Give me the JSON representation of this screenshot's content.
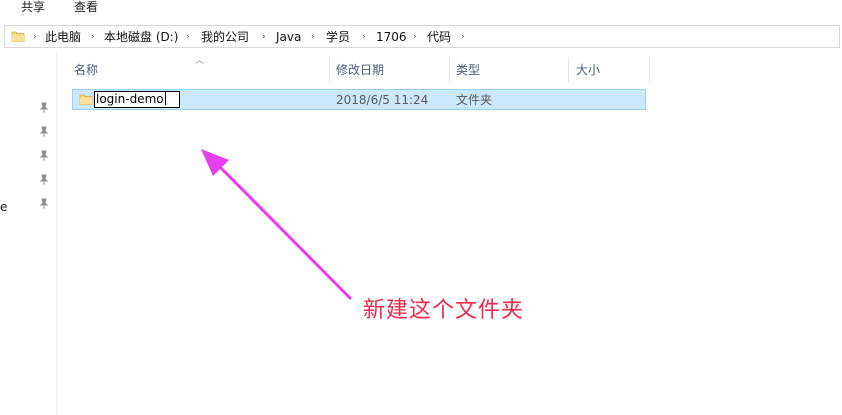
{
  "ribbon": {
    "tabs": [
      "共享",
      "查看"
    ]
  },
  "breadcrumb": {
    "items": [
      "此电脑",
      "本地磁盘 (D:)",
      "我的公司",
      "Java",
      "学员",
      "1706",
      "代码"
    ],
    "separator": "›"
  },
  "navpane": {
    "partial_text": "e"
  },
  "columns": {
    "name": "名称",
    "modified": "修改日期",
    "type": "类型",
    "size": "大小"
  },
  "file": {
    "name": "login-demo",
    "modified": "2018/6/5 11:24",
    "type": "文件夹",
    "size": ""
  },
  "annotation": {
    "text": "新建这个文件夹",
    "color": "#ee2b4a",
    "arrow_color": "#e83cf0"
  },
  "colors": {
    "selection_bg": "#cce8ff",
    "selection_border": "#99d1ff",
    "folder_yellow": "#f8d775",
    "header_text": "#4c607a"
  },
  "icons": [
    "folder-icon",
    "chevron-right-icon",
    "pin-icon",
    "sort-up-icon",
    "arrow-annotation"
  ]
}
